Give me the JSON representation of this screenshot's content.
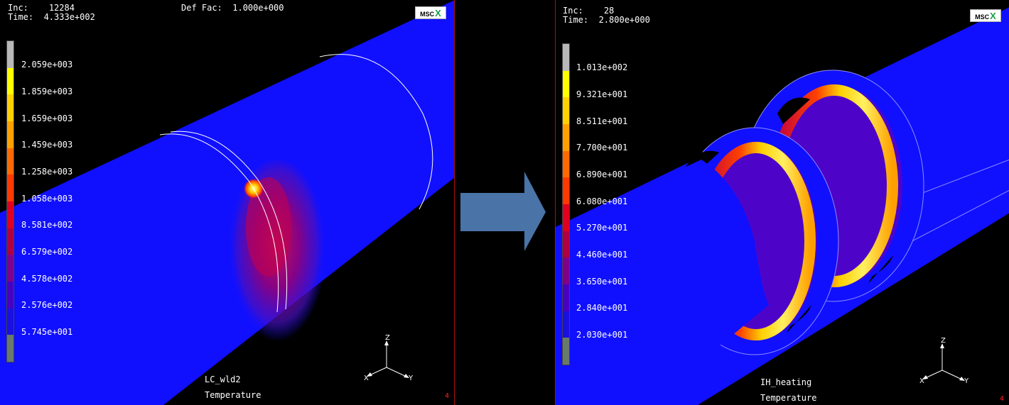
{
  "left": {
    "inc_label": "Inc:",
    "inc_value": "12284",
    "time_label": "Time:",
    "time_value": "4.333e+002",
    "deffac_label": "Def Fac:",
    "deffac_value": "1.000e+000",
    "logo": "MSC",
    "legend_values": [
      "2.059e+003",
      "1.859e+003",
      "1.659e+003",
      "1.459e+003",
      "1.258e+003",
      "1.058e+003",
      "8.581e+002",
      "6.579e+002",
      "4.578e+002",
      "2.576e+002",
      "5.745e+001"
    ],
    "loadcase": "LC_wld2",
    "variable": "Temperature",
    "corner_number": "4",
    "axis": {
      "z": "Z",
      "y": "Y",
      "x": "X"
    }
  },
  "right": {
    "inc_label": "Inc:",
    "inc_value": "28",
    "time_label": "Time:",
    "time_value": "2.800e+000",
    "logo": "MSC",
    "legend_values": [
      "1.013e+002",
      "9.321e+001",
      "8.511e+001",
      "7.700e+001",
      "6.890e+001",
      "6.080e+001",
      "5.270e+001",
      "4.460e+001",
      "3.650e+001",
      "2.840e+001",
      "2.030e+001"
    ],
    "loadcase": "IH_heating",
    "variable": "Temperature",
    "corner_number": "4",
    "axis": {
      "z": "Z",
      "y": "Y",
      "x": "X"
    }
  },
  "colors": {
    "colorbar": [
      "#b8b8b8",
      "#ffff00",
      "#ffd000",
      "#ffa000",
      "#ff6a00",
      "#ff3800",
      "#e00020",
      "#b00040",
      "#80008a",
      "#4a00c0",
      "#1a10e0",
      "#6a7a6a"
    ],
    "model_blue": "#1010ff",
    "arrow": "#4a73a8",
    "frame_red": "#b01010"
  }
}
